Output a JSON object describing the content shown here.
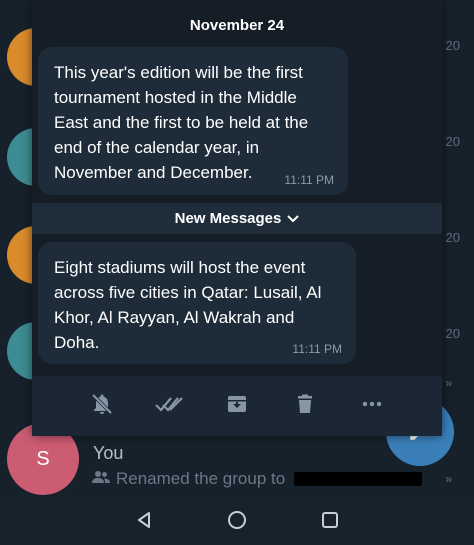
{
  "background": {
    "time_labels": [
      "20",
      "20",
      "20",
      "20"
    ],
    "avatar_colors": [
      "#d98b2b",
      "#3d8c93",
      "#d98b2b",
      "#3d8c93"
    ]
  },
  "popup": {
    "date_header": "November 24",
    "messages": [
      {
        "text": "This year's edition will be the first tournament hosted in the Middle East and the first to be held at the end of the calendar year, in November and December.",
        "time": "11:11 PM"
      },
      {
        "text": "Eight stadiums will host the event across five cities in Qatar: Lusail, Al Khor, Al Rayyan, Al Wakrah and Doha.",
        "time": "11:11 PM"
      }
    ],
    "new_messages_label": "New Messages",
    "actions": [
      "mute-icon",
      "read-all-icon",
      "archive-icon",
      "delete-icon",
      "more-icon"
    ]
  },
  "chat_row": {
    "avatar_letter": "S",
    "name": "You",
    "subtitle": "Renamed the group to"
  },
  "colors": {
    "accent": "#3a7fb9",
    "avatar_s": "#cc5c72"
  }
}
